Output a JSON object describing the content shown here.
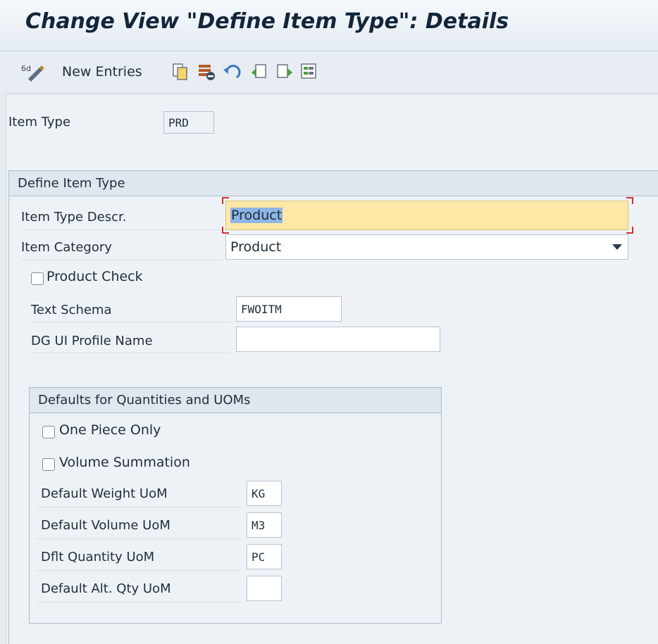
{
  "window": {
    "title": "Change View \"Define Item Type\": Details"
  },
  "toolbar": {
    "new_entries_label": "New Entries",
    "icons": [
      "display-change-icon",
      "copy-icon",
      "delete-icon",
      "undo-icon",
      "previous-entry-icon",
      "next-entry-icon",
      "select-all-icon"
    ]
  },
  "header": {
    "item_type_label": "Item Type",
    "item_type_value": "PRD"
  },
  "define_item_type": {
    "title": "Define Item Type",
    "descr_label": "Item Type Descr.",
    "descr_value": "Product",
    "category_label": "Item Category",
    "category_value": "Product",
    "product_check_label": "Product Check",
    "product_check_checked": false,
    "text_schema_label": "Text Schema",
    "text_schema_value": "FWOITM",
    "dg_profile_label": "DG UI Profile Name",
    "dg_profile_value": ""
  },
  "defaults_group": {
    "title": "Defaults for Quantities and UOMs",
    "one_piece_label": "One Piece Only",
    "one_piece_checked": false,
    "volume_sum_label": "Volume Summation",
    "volume_sum_checked": false,
    "weight_uom_label": "Default Weight UoM",
    "weight_uom_value": "KG",
    "volume_uom_label": "Default Volume UoM",
    "volume_uom_value": "M3",
    "qty_uom_label": "Dflt Quantity UoM",
    "qty_uom_value": "PC",
    "alt_qty_uom_label": "Default Alt. Qty UoM",
    "alt_qty_uom_value": ""
  },
  "colors": {
    "focus_field_bg": "#ffe8a6",
    "focus_corner": "#d23030",
    "background": "#eef2f6"
  }
}
